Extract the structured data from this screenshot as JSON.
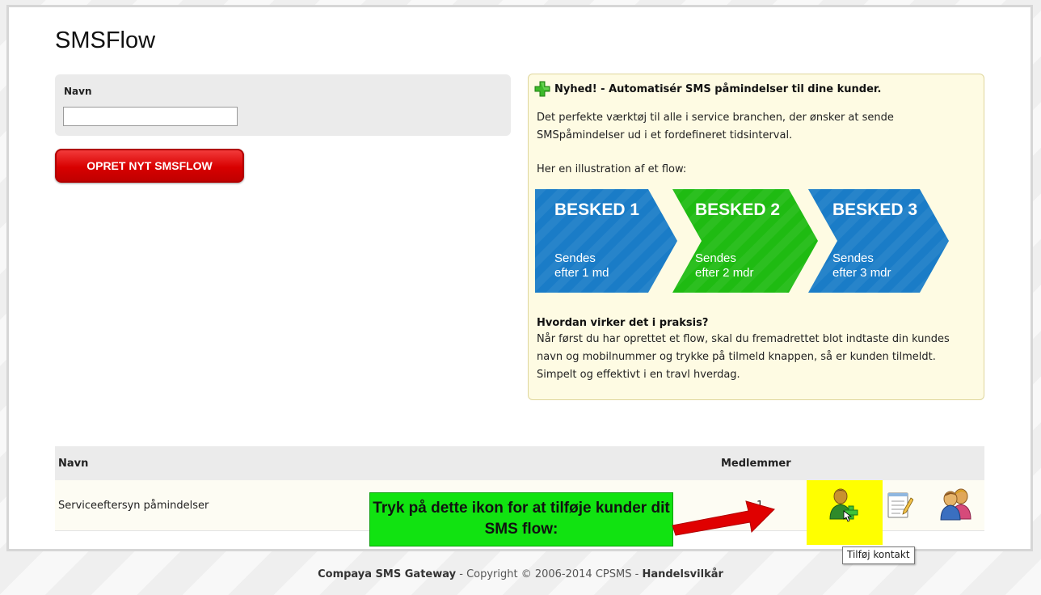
{
  "page": {
    "title": "SMSFlow"
  },
  "form": {
    "name_label": "Navn",
    "name_value": "",
    "name_placeholder": "",
    "create_button": "OPRET NYT SMSFLOW"
  },
  "info": {
    "title": "Nyhed! - Automatisér SMS påmindelser til dine kunder.",
    "description": "Det perfekte værktøj til alle i service branchen, der ønsker at sende SMSpåmindelser ud i et fordefineret tidsinterval.",
    "illustration_text": "Her en illustration af et flow:",
    "steps": [
      {
        "title": "BESKED 1",
        "line1": "Sendes",
        "line2": "efter 1 md",
        "color": "#1a7cc7"
      },
      {
        "title": "BESKED 2",
        "line1": "Sendes",
        "line2": "efter 2 mdr",
        "color": "#1fbb12"
      },
      {
        "title": "BESKED 3",
        "line1": "Sendes",
        "line2": "efter 3 mdr",
        "color": "#1a7cc7"
      }
    ],
    "howto_heading": "Hvordan virker det i praksis?",
    "howto_body": "Når først du har oprettet et flow, skal du fremadrettet blot indtaste din kundes navn og mobilnummer og trykke på tilmeld knappen, så er kunden tilmeldt. Simpelt og effektivt i en travl hverdag."
  },
  "table": {
    "headers": {
      "name": "Navn",
      "members": "Medlemmer"
    },
    "rows": [
      {
        "name": "Serviceeftersyn påmindelser",
        "members": "1"
      }
    ],
    "icons": [
      "add-contact-icon",
      "notes-icon",
      "members-icon"
    ]
  },
  "annotation": {
    "callout": "Tryk på dette ikon for at tilføje kunder dit SMS flow:",
    "tooltip": "Tilføj kontakt",
    "callout_color": "#11e311",
    "highlight_color": "#ffff00",
    "arrow_color": "#e00000"
  },
  "footer": {
    "brand": "Compaya SMS Gateway",
    "copyright": "Copyright © 2006-2014 CPSMS",
    "terms": "Handelsvilkår"
  }
}
